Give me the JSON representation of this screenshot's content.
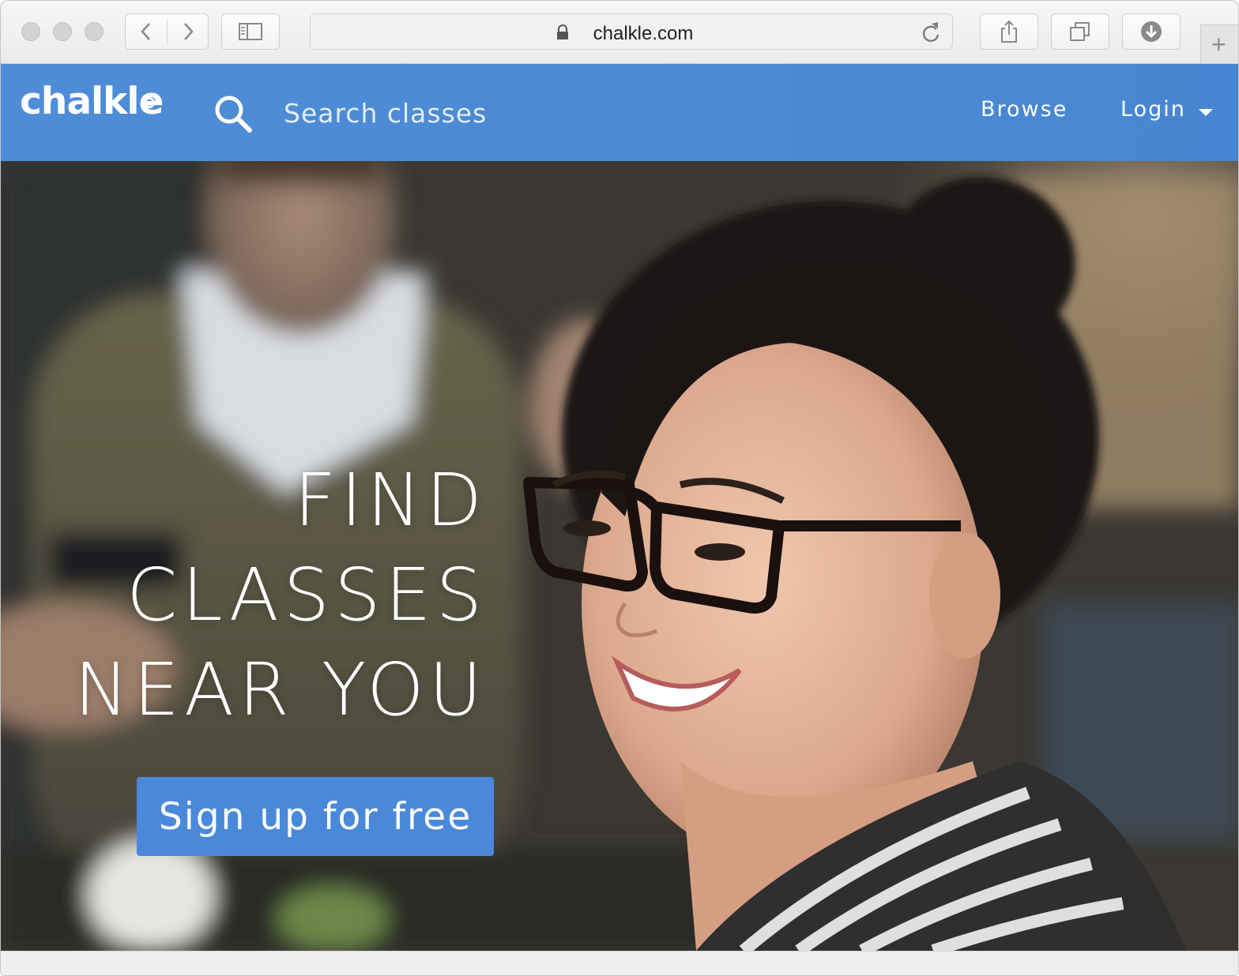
{
  "browser": {
    "url": "chalkle.com",
    "new_tab_symbol": "+"
  },
  "site": {
    "logo": "chalkle",
    "search": {
      "placeholder": "Search classes",
      "value": ""
    },
    "nav": {
      "browse": "Browse",
      "login": "Login"
    },
    "brand_color": "#4a89d3"
  },
  "hero": {
    "headline_lines": [
      "FIND",
      "CLASSES",
      "NEAR YOU"
    ],
    "cta_label": "Sign up for free",
    "cta_color": "#4a89da"
  }
}
